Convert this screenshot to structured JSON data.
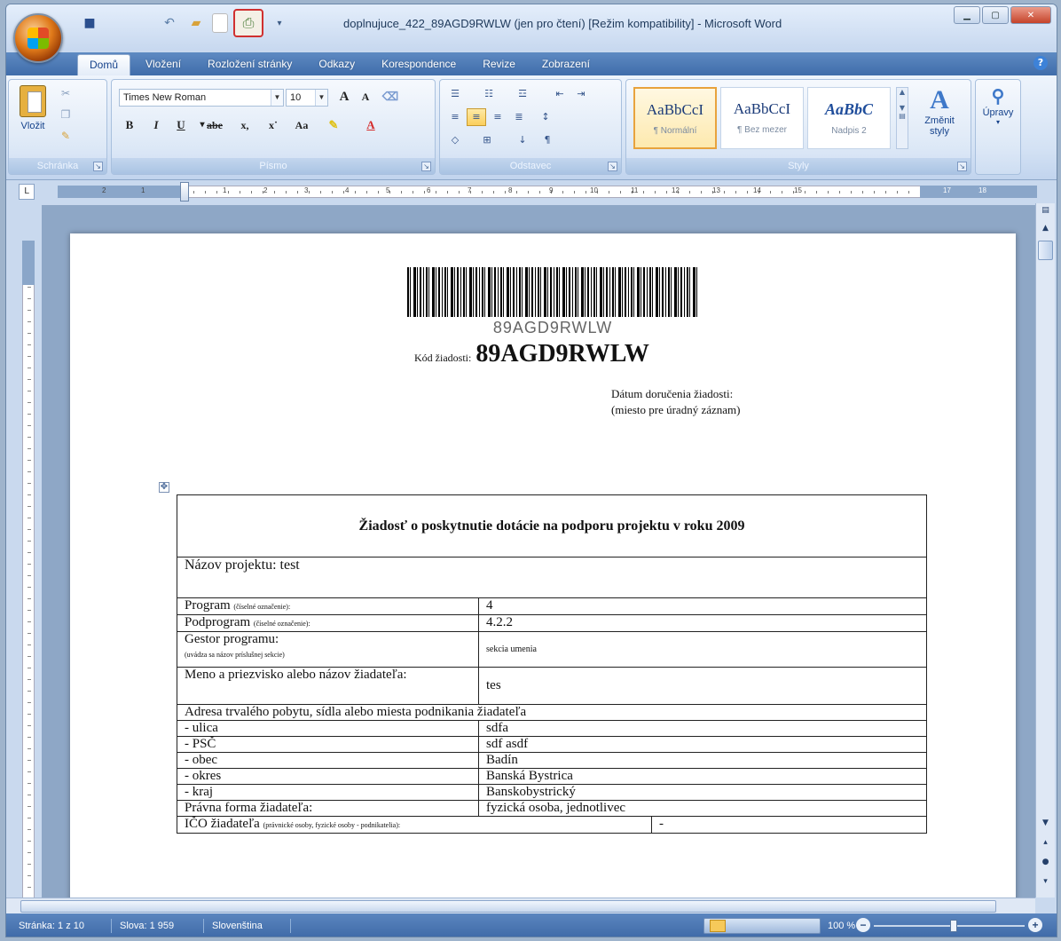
{
  "window": {
    "title": "doplnujuce_422_89AGD9RWLW (jen pro čtení) [Režim kompatibility] - Microsoft Word"
  },
  "qat": {
    "icons": [
      "save-icon",
      "undo-icon",
      "open-icon",
      "new-document-icon",
      "print-preview-icon",
      "customize-icon"
    ]
  },
  "tabs": [
    "Domů",
    "Vložení",
    "Rozložení stránky",
    "Odkazy",
    "Korespondence",
    "Revize",
    "Zobrazení"
  ],
  "ribbon": {
    "clipboard": {
      "label": "Schránka",
      "paste": "Vložit"
    },
    "font": {
      "label": "Písmo",
      "family": "Times New Roman",
      "size": "10",
      "grow": "A",
      "shrink": "A",
      "bold": "B",
      "italic": "I",
      "underline": "U",
      "strike": "abe",
      "subscript": "x,",
      "superscript": "x˙",
      "case": "Aa"
    },
    "paragraph": {
      "label": "Odstavec",
      "pilcrow": "¶",
      "sort": "↓"
    },
    "styles": {
      "label": "Styly",
      "items": [
        {
          "sample": "AaBbCcI",
          "name": "¶ Normální"
        },
        {
          "sample": "AaBbCcI",
          "name": "¶ Bez mezer"
        },
        {
          "sample": "AaBbC",
          "name": "Nadpis 2"
        }
      ],
      "change_styles": "Změnit styly",
      "editing": "Úpravy"
    }
  },
  "ruler": {
    "numbers": [
      "2",
      "1",
      "1",
      "2",
      "3",
      "4",
      "5",
      "6",
      "7",
      "8",
      "9",
      "10",
      "11",
      "12",
      "13",
      "14",
      "15",
      "17",
      "18"
    ]
  },
  "document": {
    "barcode_text": "89AGD9RWLW",
    "code_label": "Kód žiadosti:",
    "code_value": "89AGD9RWLW",
    "date_line1": "Dátum doručenia žiadosti:",
    "date_line2": "(miesto pre úradný záznam)",
    "table": {
      "title": "Žiadosť o poskytnutie dotácie na podporu projektu v roku 2009",
      "project_name": "Názov projektu: test",
      "program_label": "Program",
      "program_small": "(číselné označenie):",
      "program_value": "4",
      "subprogram_label": "Podprogram",
      "subprogram_small": "(číselné označenie):",
      "subprogram_value": "4.2.2",
      "gestor_label": "Gestor programu:",
      "gestor_small": "(uvádza sa názov príslušnej sekcie)",
      "gestor_value": "sekcia umenia",
      "applicant_label": "Meno a priezvisko alebo názov žiadateľa:",
      "applicant_value": "tes",
      "address_header": "Adresa trvalého pobytu, sídla alebo miesta podnikania žiadateľa",
      "address_rows": [
        {
          "label": "- ulica",
          "value": "sdfa"
        },
        {
          "label": "- PSČ",
          "value": "sdf asdf"
        },
        {
          "label": "- obec",
          "value": "Badín"
        },
        {
          "label": "- okres",
          "value": "Banská Bystrica"
        },
        {
          "label": "- kraj",
          "value": "Banskobystrický"
        }
      ],
      "legal_form_label": "Právna forma žiadateľa:",
      "legal_form_value": "fyzická osoba, jednotlivec",
      "ico_label": "IČO žiadateľa",
      "ico_small": "(právnické osoby, fyzické osoby - podnikatelia):",
      "ico_value": "-"
    }
  },
  "statusbar": {
    "page": "Stránka: 1 z 10",
    "words": "Slova: 1 959",
    "language": "Slovenština",
    "zoom": "100 %"
  }
}
